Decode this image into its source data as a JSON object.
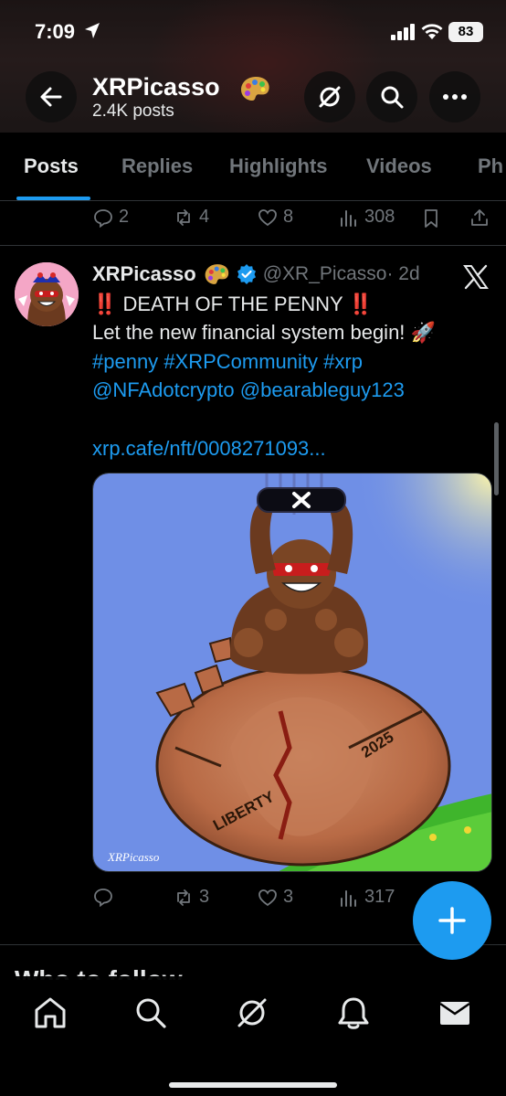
{
  "status_bar": {
    "time": "7:09",
    "battery": "83"
  },
  "profile": {
    "name": "XRPicasso",
    "emoji": "🎨",
    "posts_count": "2.4K posts"
  },
  "tabs": [
    {
      "label": "Posts",
      "active": true
    },
    {
      "label": "Replies"
    },
    {
      "label": "Highlights"
    },
    {
      "label": "Videos"
    },
    {
      "label": "Ph"
    }
  ],
  "previous_post_actions": {
    "replies": "2",
    "reposts": "4",
    "likes": "8",
    "views": "308"
  },
  "post": {
    "author_name": "XRPicasso",
    "author_emoji": "🎨",
    "handle": "@XR_Picasso",
    "time": "· 2d",
    "line1": "‼️ DEATH OF THE PENNY ‼️",
    "line2": "Let the new financial system begin! 🚀",
    "hashtags": [
      "#penny",
      "#XRPCommunity",
      "#xrp"
    ],
    "mentions": [
      "@NFAdotcrypto",
      "@bearableguy123"
    ],
    "link": "xrp.cafe/nft/0008271093...",
    "image_text": {
      "penny_year": "2025",
      "penny_motto": "LIBERTY",
      "signature": "XRPicasso"
    },
    "actions": {
      "replies": "",
      "reposts": "3",
      "likes": "3",
      "views": "317"
    }
  },
  "section_heading": "Who to follow",
  "colors": {
    "accent": "#1d9bf0",
    "muted": "#71767b",
    "text": "#e7e9ea",
    "background": "#000000"
  },
  "icons": [
    "back-arrow-icon",
    "grok-icon",
    "search-icon",
    "more-icon",
    "reply-icon",
    "repost-icon",
    "like-icon",
    "views-icon",
    "bookmark-icon",
    "share-icon",
    "verified-icon",
    "x-logo-icon",
    "compose-plus-icon",
    "home-icon",
    "explore-icon",
    "grok-nav-icon",
    "notifications-icon",
    "messages-icon"
  ]
}
